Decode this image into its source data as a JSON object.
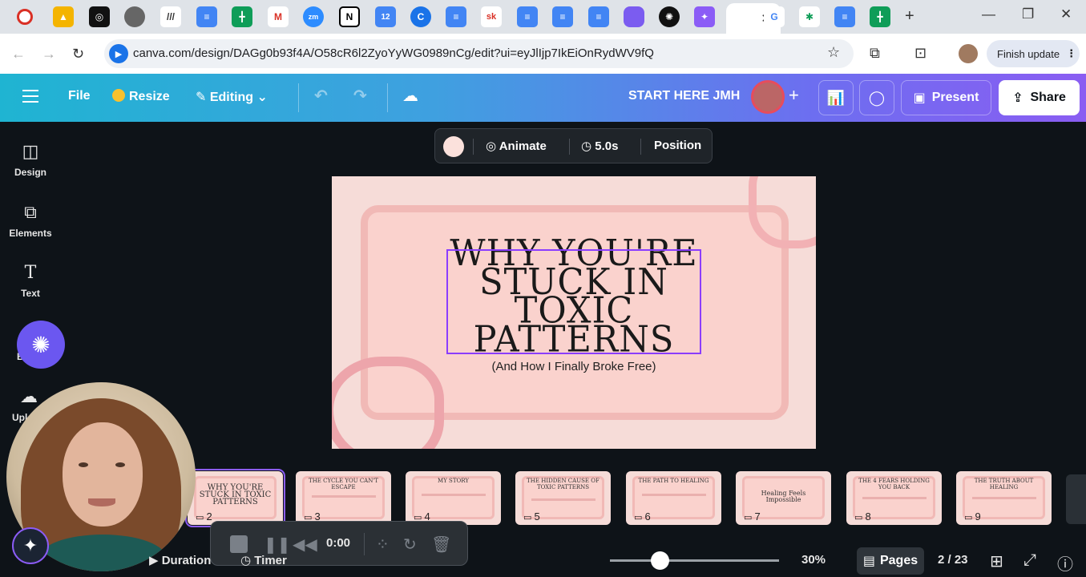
{
  "browser": {
    "url": "canva.com/design/DAGg0b93f4A/O58cR6l2ZyoYyWG0989nCg/edit?ui=eyJlIjp7IkEiOnRydWV9fQ",
    "finish_update": "Finish update",
    "active_tab_close": "✕",
    "tab_icons": [
      "record-icon",
      "drive-icon",
      "chatgpt-icon",
      "app-icon",
      "app-icon",
      "docs-icon",
      "sheets-icon",
      "gmail-icon",
      "zoom-icon",
      "notion-icon",
      "calendar-icon",
      "app-icon",
      "docs-icon",
      "sk-icon",
      "docs-icon",
      "docs-icon",
      "docs-icon",
      "app-icon",
      "openai-icon",
      "canva-icon",
      "google-icon",
      "app-icon",
      "docs-icon",
      "sheets-icon"
    ]
  },
  "toolbar": {
    "file": "File",
    "resize": "Resize",
    "editing": "Editing",
    "design_name": "START HERE JMH",
    "present": "Present",
    "share": "Share"
  },
  "sidebar": {
    "items": [
      {
        "label": "Design",
        "icon": "design-icon"
      },
      {
        "label": "Elements",
        "icon": "elements-icon"
      },
      {
        "label": "Text",
        "icon": "text-icon"
      },
      {
        "label": "B",
        "icon": "brand-icon"
      },
      {
        "label": "Upl",
        "icon": "uploads-icon"
      }
    ]
  },
  "floating_toolbar": {
    "animate": "Animate",
    "duration": "5.0s",
    "position": "Position"
  },
  "slide": {
    "title_lines": [
      "WHY YOU'RE",
      "STUCK IN",
      "TOXIC",
      "PATTERNS"
    ],
    "subtitle": "(And How I Finally Broke Free)"
  },
  "thumbnails": [
    {
      "num": "2",
      "title": "WHY YOU'RE STUCK IN TOXIC PATTERNS",
      "selected": true
    },
    {
      "num": "3",
      "title": "THE CYCLE YOU CAN'T ESCAPE"
    },
    {
      "num": "4",
      "title": "MY STORY"
    },
    {
      "num": "5",
      "title": "THE HIDDEN CAUSE OF TOXIC PATTERNS"
    },
    {
      "num": "6",
      "title": "THE PATH TO HEALING"
    },
    {
      "num": "7",
      "title": "Healing Feels Impossible"
    },
    {
      "num": "8",
      "title": "THE 4 FEARS HOLDING YOU BACK"
    },
    {
      "num": "9",
      "title": "THE TRUTH ABOUT HEALING"
    }
  ],
  "player": {
    "time": "0:00"
  },
  "bottom": {
    "duration": "Duration",
    "timer": "Timer",
    "zoom": "30%",
    "zoom_fraction": 0.3,
    "pages": "Pages",
    "page_count": "2 / 23"
  },
  "colors": {
    "accent": "#8b5cf6",
    "slide_bg": "#f6dcd8",
    "slide_frame": "#f1b9b6"
  }
}
